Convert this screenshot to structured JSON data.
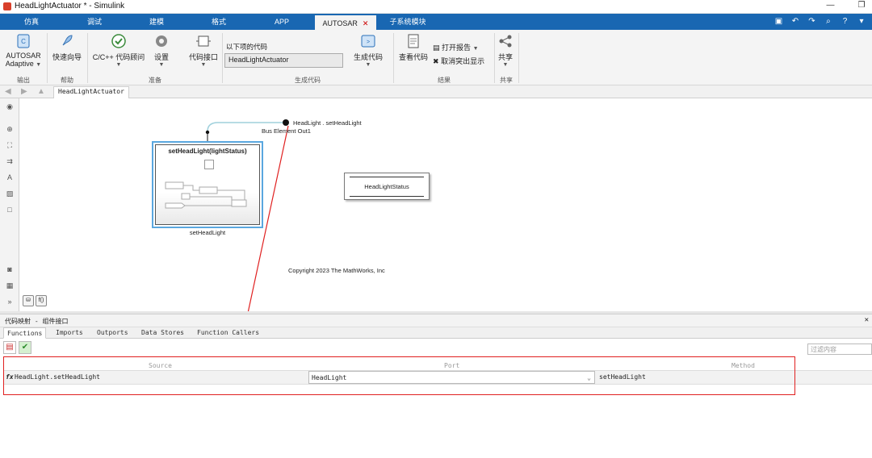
{
  "window": {
    "title": "HeadLightActuator * - Simulink",
    "minimize": "—",
    "restore": "❐"
  },
  "tabs": [
    {
      "label": "仿真"
    },
    {
      "label": "调试"
    },
    {
      "label": "建模"
    },
    {
      "label": "格式"
    },
    {
      "label": "APP"
    },
    {
      "label": "AUTOSAR"
    },
    {
      "label": "子系统模块"
    }
  ],
  "ribbon": {
    "autosar_line1": "AUTOSAR",
    "autosar_line2": "Adaptive",
    "quick_start": "快速向导",
    "cpp_advisor": "C/C++ 代码顾问",
    "settings": "设置",
    "code_interface": "代码接口",
    "code_for_label": "以下项的代码",
    "code_for_value": "HeadLightActuator",
    "generate_code": "生成代码",
    "view_code": "查看代码",
    "open_report": "打开报告",
    "remove_highlight": "取消突出显示",
    "share": "共享",
    "groups": {
      "output": "输出",
      "help": "帮助",
      "prepare": "准备",
      "generate": "生成代码",
      "results": "结果",
      "share": "共享"
    }
  },
  "breadcrumb": "HeadLightActuator",
  "canvas": {
    "block_title": "setHeadLight(lightStatus)",
    "block_name": "setHeadLight",
    "bus_element_port": "HeadLight . setHeadLight",
    "bus_element_name": "Bus Element Out1",
    "data_store": "HeadLightStatus",
    "copyright": "Copyright 2023 The MathWorks, Inc"
  },
  "panel": {
    "title": "代码映射 - 组件接口",
    "tabs": [
      "Functions",
      "Imports",
      "Outports",
      "Data Stores",
      "Function Callers"
    ],
    "filter_placeholder": "过滤内容",
    "columns": {
      "source": "Source",
      "port": "Port",
      "method": "Method"
    },
    "row": {
      "icon": "fx",
      "source": "HeadLight.setHeadLight",
      "port": "HeadLight",
      "method": "setHeadLight"
    }
  },
  "colors": {
    "tab_bar": "#1967b2",
    "highlight": "#e02020",
    "block_border": "#5aa7df"
  }
}
